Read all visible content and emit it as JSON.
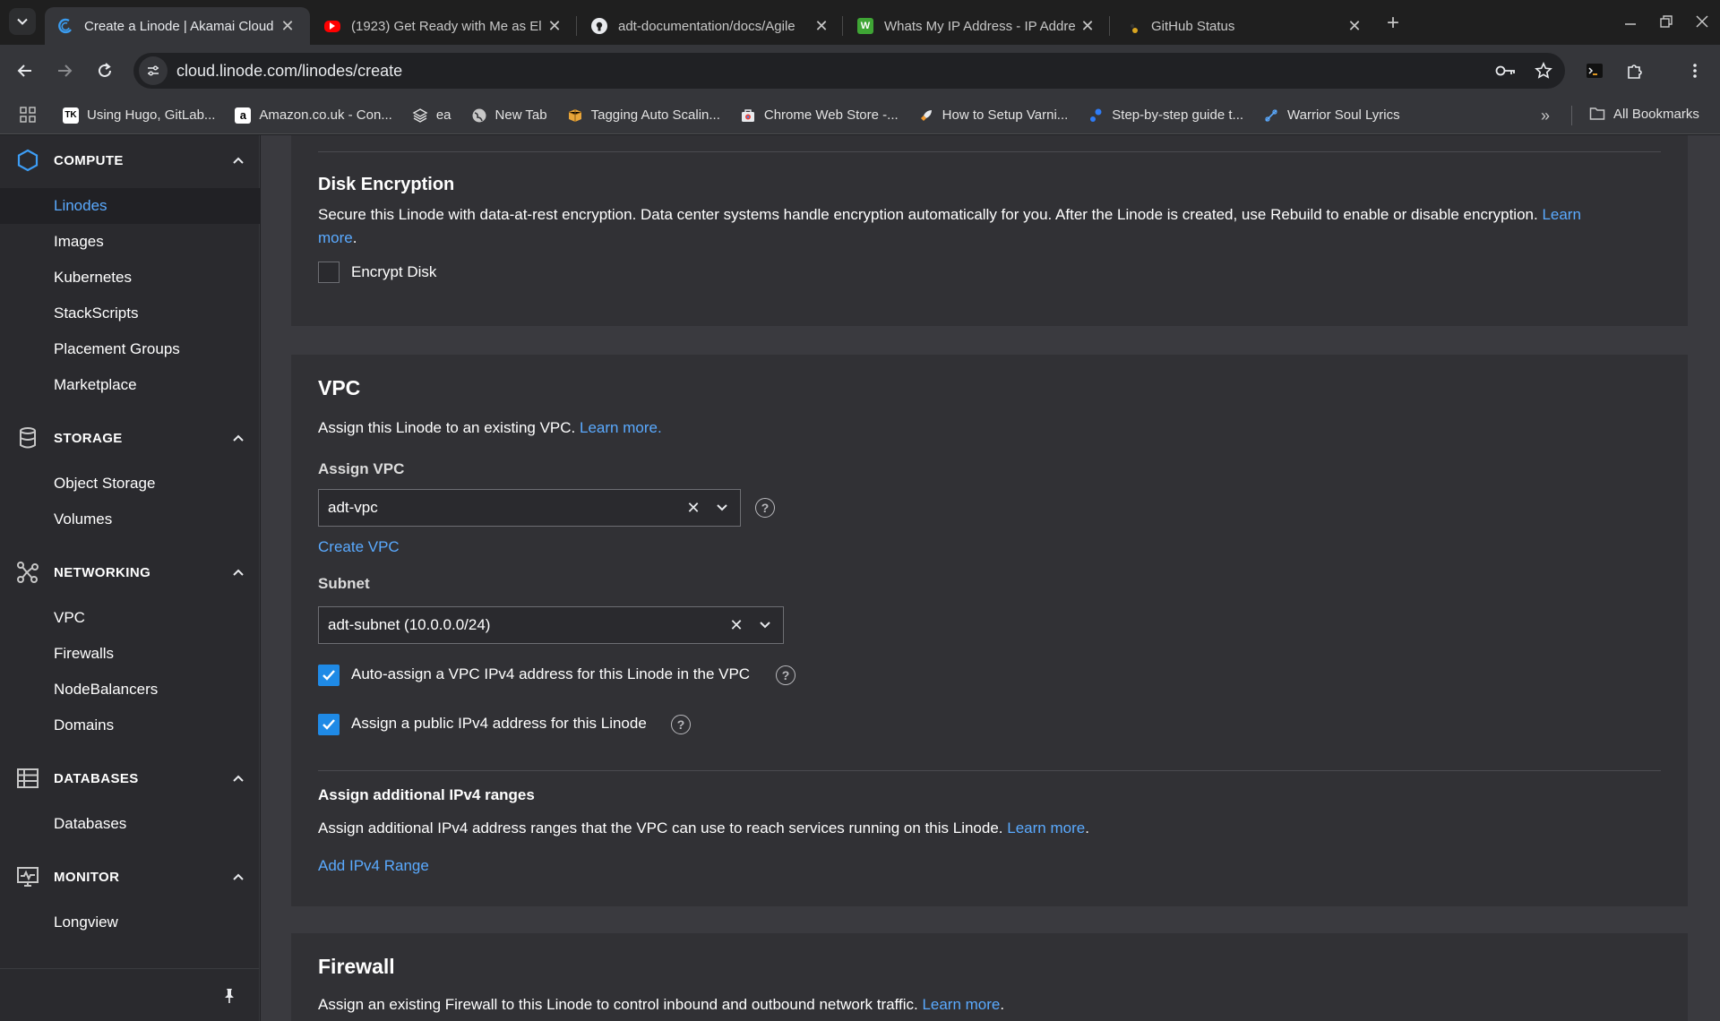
{
  "browser": {
    "tabs": [
      {
        "title": "Create a Linode | Akamai Cloud",
        "favicon": "akamai-icon",
        "active": true
      },
      {
        "title": "(1923) Get Ready with Me as El",
        "favicon": "youtube-icon",
        "active": false
      },
      {
        "title": "adt-documentation/docs/Agile",
        "favicon": "github-icon",
        "active": false
      },
      {
        "title": "Whats My IP Address - IP Addre",
        "favicon": "w-icon",
        "active": false
      },
      {
        "title": "GitHub Status",
        "favicon": "status-icon",
        "active": false
      }
    ],
    "url": "cloud.linode.com/linodes/create",
    "bookmarks": [
      {
        "label": "Using Hugo, GitLab...",
        "icon": "tk-icon"
      },
      {
        "label": "Amazon.co.uk - Con...",
        "icon": "amazon-icon"
      },
      {
        "label": "ea",
        "icon": "layers-icon"
      },
      {
        "label": "New Tab",
        "icon": "globe-icon"
      },
      {
        "label": "Tagging Auto Scalin...",
        "icon": "aws-icon"
      },
      {
        "label": "Chrome Web Store -...",
        "icon": "store-icon"
      },
      {
        "label": "How to Setup Varni...",
        "icon": "rocket-icon"
      },
      {
        "label": "Step-by-step guide t...",
        "icon": "dot-icon"
      },
      {
        "label": "Warrior Soul Lyrics",
        "icon": "music-icon"
      }
    ],
    "all_bookmarks": "All Bookmarks",
    "colors": {
      "accent": "#5aaaff",
      "checkbox": "#1f8ae6"
    }
  },
  "sidebar": {
    "sections": [
      {
        "title": "COMPUTE",
        "icon": "hexagon-icon",
        "items": [
          "Linodes",
          "Images",
          "Kubernetes",
          "StackScripts",
          "Placement Groups",
          "Marketplace"
        ]
      },
      {
        "title": "STORAGE",
        "icon": "storage-icon",
        "items": [
          "Object Storage",
          "Volumes"
        ]
      },
      {
        "title": "NETWORKING",
        "icon": "network-icon",
        "items": [
          "VPC",
          "Firewalls",
          "NodeBalancers",
          "Domains"
        ]
      },
      {
        "title": "DATABASES",
        "icon": "database-icon",
        "items": [
          "Databases"
        ]
      },
      {
        "title": "MONITOR",
        "icon": "monitor-icon",
        "items": [
          "Longview"
        ]
      }
    ],
    "active_item": "Linodes"
  },
  "disk_encryption": {
    "title": "Disk Encryption",
    "description": "Secure this Linode with data-at-rest encryption. Data center systems handle encryption automatically for you. After the Linode is created, use Rebuild to enable or disable encryption.",
    "learn_more_1": "Learn",
    "learn_more_2": "more",
    "checkbox_label": "Encrypt Disk",
    "checked": false
  },
  "vpc": {
    "title": "VPC",
    "description": "Assign this Linode to an existing VPC.",
    "learn_more": "Learn more.",
    "assign_label": "Assign VPC",
    "assign_value": "adt-vpc",
    "create_link": "Create VPC",
    "subnet_label": "Subnet",
    "subnet_value": "adt-subnet (10.0.0.0/24)",
    "auto_assign_label": "Auto-assign a VPC IPv4 address for this Linode in the VPC",
    "public_ipv4_label": "Assign a public IPv4 address for this Linode",
    "ranges_title": "Assign additional IPv4 ranges",
    "ranges_description": "Assign additional IPv4 address ranges that the VPC can use to reach services running on this Linode.",
    "ranges_learn_more": "Learn more",
    "add_range": "Add IPv4 Range"
  },
  "firewall": {
    "title": "Firewall",
    "description": "Assign an existing Firewall to this Linode to control inbound and outbound network traffic.",
    "learn_more": "Learn more"
  }
}
